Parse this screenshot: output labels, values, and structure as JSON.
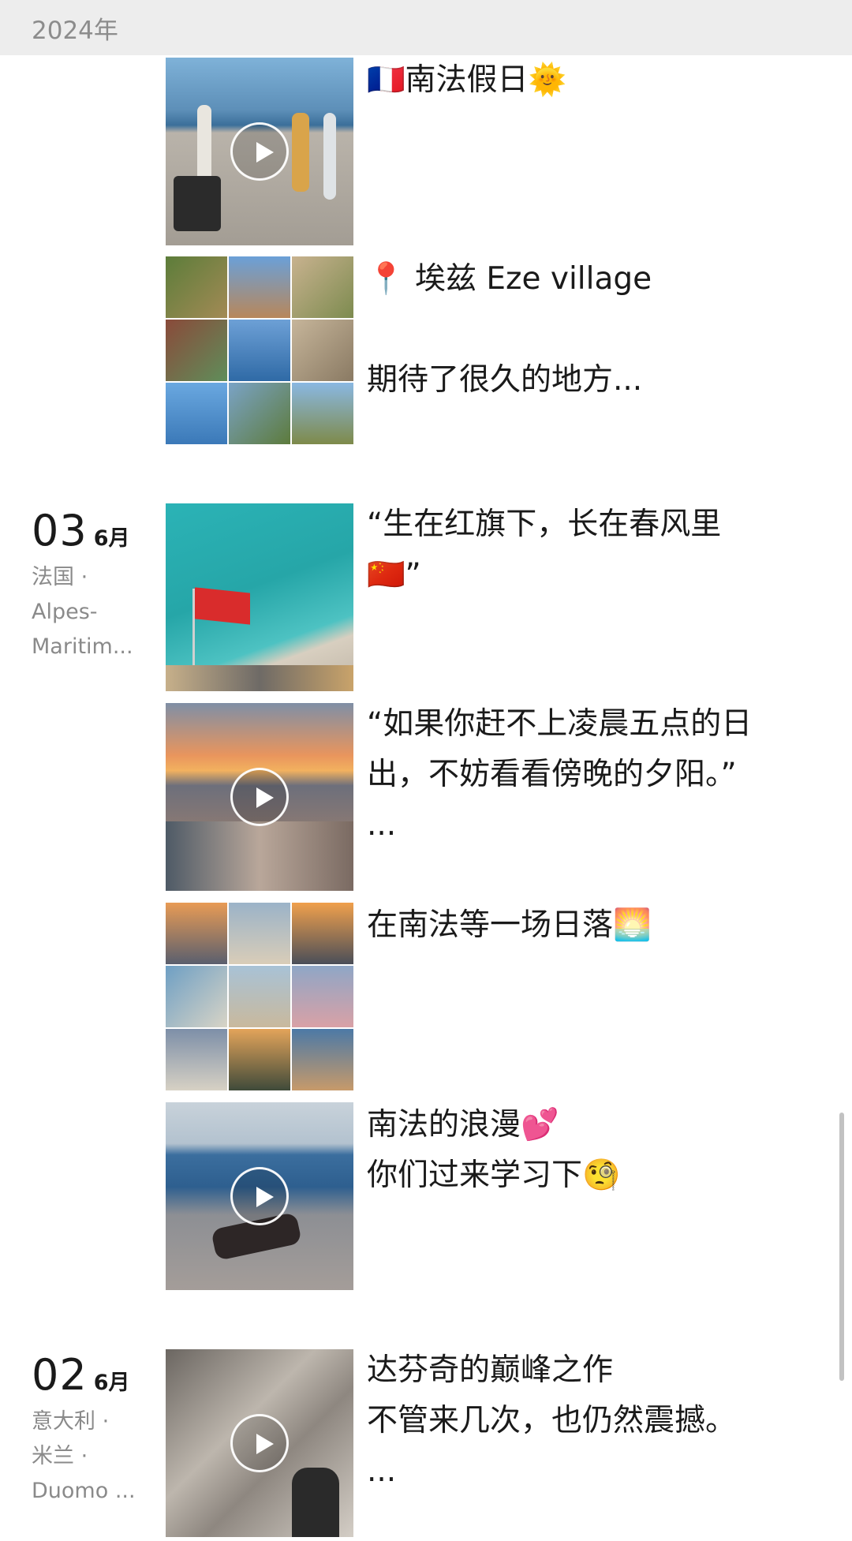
{
  "header": {
    "year": "2024年"
  },
  "groups": [
    {
      "posts": [
        {
          "caption": "🇫🇷南法假日🌞",
          "type": "video"
        },
        {
          "caption": "📍 埃兹 Eze village\n\n期待了很久的地方...",
          "type": "grid9"
        }
      ]
    },
    {
      "day": "03",
      "month": "6月",
      "location": "法国 ·\nAlpes-\nMaritim...",
      "posts": [
        {
          "caption": "“生在红旗下，长在春风里\n🇨🇳”",
          "type": "image"
        },
        {
          "caption": "“如果你赶不上凌晨五点的日\n出，不妨看看傍晚的夕阳。”\n...",
          "type": "video"
        },
        {
          "caption": "在南法等一场日落🌅",
          "type": "grid9"
        },
        {
          "caption": "南法的浪漫💕\n你们过来学习下🧐",
          "type": "video"
        }
      ]
    },
    {
      "day": "02",
      "month": "6月",
      "location": "意大利 ·\n米兰 ·\nDuomo ...",
      "posts": [
        {
          "caption": "达芬奇的巅峰之作\n不管来几次，也仍然震撼。\n...",
          "type": "video"
        }
      ]
    }
  ]
}
